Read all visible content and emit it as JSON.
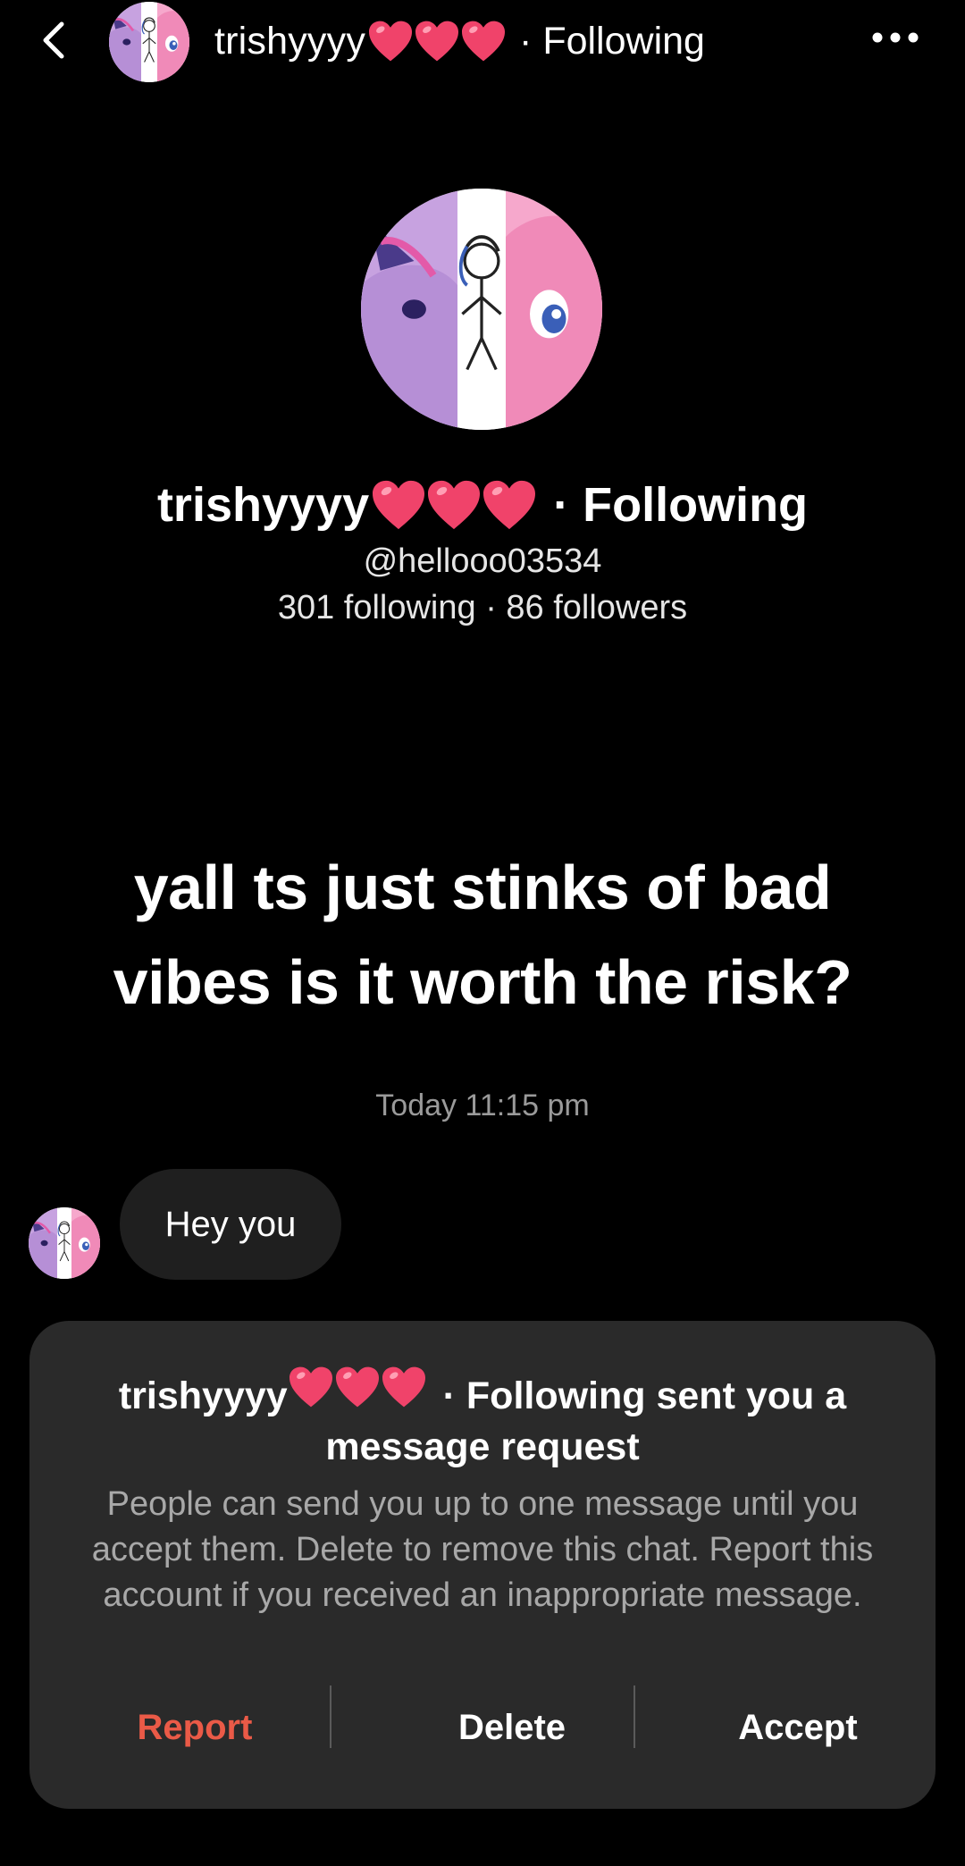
{
  "header": {
    "back_icon": "chevron-left-icon",
    "name": "trishyyyy",
    "follow_status": "· Following",
    "more_icon": "ellipsis-icon"
  },
  "profile": {
    "name": "trishyyyy",
    "follow_status": "· Following",
    "handle": "@hellooo03534",
    "stats": "301 following · 86 followers"
  },
  "post": {
    "caption": "yall ts just stinks of bad vibes is it worth the risk?"
  },
  "chat": {
    "timestamp": "Today 11:15 pm",
    "message": "Hey you"
  },
  "request_card": {
    "name": "trishyyyy",
    "title_rest": "· Following sent you a message request",
    "body": "People can send you up to one message until you accept them. Delete to remove this chat. Report this account if you received an inappropriate message.",
    "actions": {
      "report": "Report",
      "delete": "Delete",
      "accept": "Accept"
    }
  },
  "colors": {
    "background": "#000000",
    "bubble": "#1f1f1f",
    "card": "#2a2a2a",
    "report": "#ea5a47",
    "heart": "#f0436a"
  }
}
